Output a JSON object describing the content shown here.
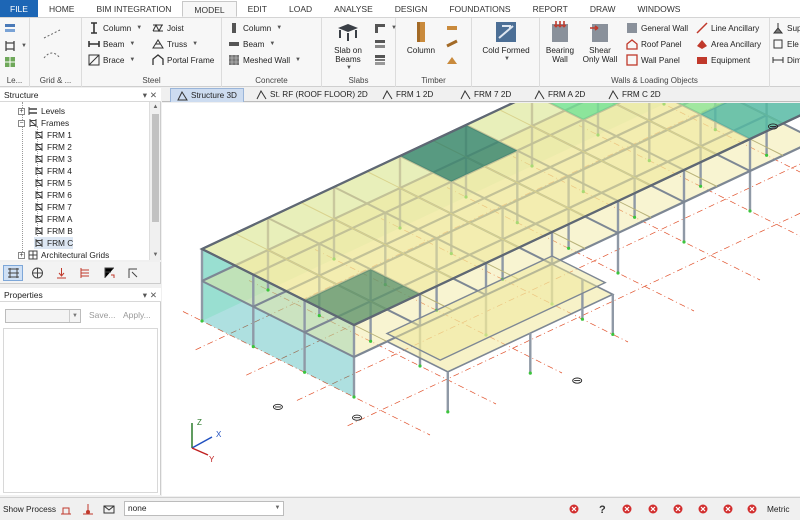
{
  "menu": {
    "tabs": [
      "FILE",
      "HOME",
      "BIM INTEGRATION",
      "MODEL",
      "EDIT",
      "LOAD",
      "ANALYSE",
      "DESIGN",
      "FOUNDATIONS",
      "REPORT",
      "DRAW",
      "WINDOWS"
    ],
    "active": "MODEL"
  },
  "ribbon": {
    "groups": {
      "levels": "Le...",
      "grid": "Grid & ...",
      "steel": "Steel",
      "concrete": "Concrete",
      "slabs": "Slabs",
      "timber": "Timber",
      "walls": "Walls & Loading Objects"
    },
    "steel": {
      "column": "Column",
      "beam": "Beam",
      "brace": "Brace",
      "joist": "Joist",
      "truss": "Truss",
      "portal": "Portal Frame"
    },
    "concrete": {
      "column": "Column",
      "beam": "Beam",
      "meshed_wall": "Meshed Wall"
    },
    "slabs": {
      "slab_on_beams": "Slab on Beams"
    },
    "timber": {
      "column": "Column"
    },
    "cold_formed": "Cold Formed",
    "walls": {
      "bearing_wall": "Bearing Wall",
      "shear_only_wall": "Shear Only Wall",
      "general_wall": "General Wall",
      "roof_panel": "Roof Panel",
      "wall_panel": "Wall Panel",
      "line_ancillary": "Line Ancillary",
      "area_ancillary": "Area Ancillary",
      "equipment": "Equipment",
      "sup": "Sup",
      "ele": "Ele",
      "dim": "Dim"
    }
  },
  "structure_panel": {
    "title": "Structure",
    "items": [
      {
        "label": "Levels",
        "level": 1
      },
      {
        "label": "Frames",
        "level": 1
      },
      {
        "label": "FRM 1",
        "level": 2
      },
      {
        "label": "FRM 2",
        "level": 2
      },
      {
        "label": "FRM 3",
        "level": 2
      },
      {
        "label": "FRM 4",
        "level": 2
      },
      {
        "label": "FRM 5",
        "level": 2
      },
      {
        "label": "FRM 6",
        "level": 2
      },
      {
        "label": "FRM 7",
        "level": 2
      },
      {
        "label": "FRM A",
        "level": 2
      },
      {
        "label": "FRM B",
        "level": 2
      },
      {
        "label": "FRM C",
        "level": 2
      },
      {
        "label": "Architectural Grids",
        "level": 1
      }
    ],
    "selected": "FRM C"
  },
  "properties_panel": {
    "title": "Properties",
    "save_label": "Save...",
    "apply_label": "Apply..."
  },
  "doc_tabs": [
    {
      "label": "Structure 3D",
      "active": true
    },
    {
      "label": "St. RF (ROOF FLOOR) 2D"
    },
    {
      "label": "FRM 1 2D"
    },
    {
      "label": "FRM 7 2D"
    },
    {
      "label": "FRM A 2D"
    },
    {
      "label": "FRM C 2D"
    }
  ],
  "axis": {
    "x": "X",
    "y": "Y",
    "z": "Z"
  },
  "status": {
    "show_process": "Show Process",
    "field_value": "none",
    "units": "Metric"
  },
  "colors": {
    "accent": "#1d66b5",
    "slab_yellow": "#f0e79a",
    "wall_green": "#3ee08e",
    "wall_teal": "#17a6a6",
    "steel_grey": "#8f99a6",
    "grid_red": "#e0502a"
  }
}
